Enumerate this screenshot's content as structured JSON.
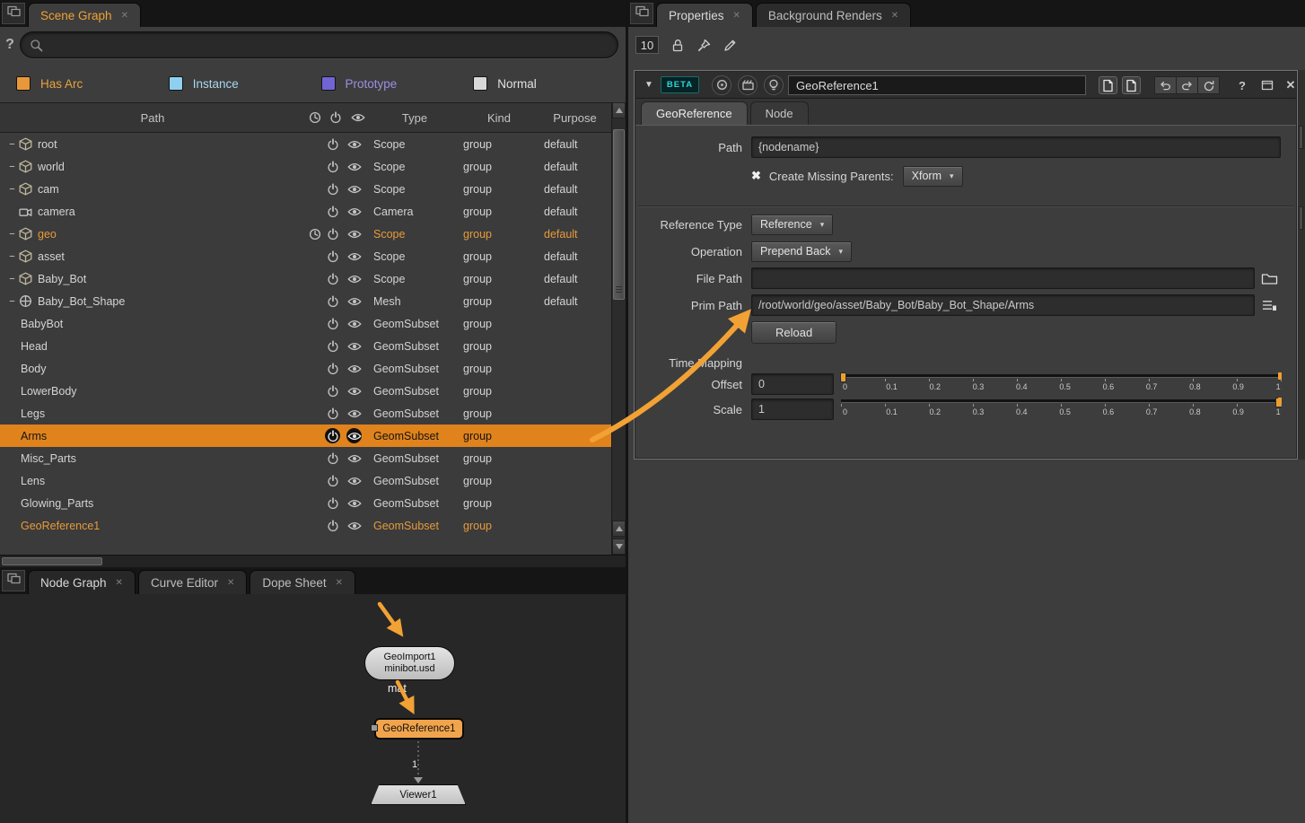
{
  "glyphs": {
    "close": "✕",
    "question": "?",
    "dd_arrow": "▾",
    "tri_down": "▼",
    "check_x": "✖",
    "collapse": "−"
  },
  "colors": {
    "accent": "#f0a132",
    "selection": "#e0831c"
  },
  "scene_graph_panel": {
    "tab_label": "Scene Graph",
    "search_value": "",
    "legend": [
      {
        "label": "Has Arc",
        "swatch": "#e8973a",
        "text_color": "#e8a33d"
      },
      {
        "label": "Instance",
        "swatch": "#8fd0f0",
        "text_color": "#a9d7ef"
      },
      {
        "label": "Prototype",
        "swatch": "#7164d4",
        "text_color": "#9b8fe2"
      },
      {
        "label": "Normal",
        "swatch": "#d8d8d8",
        "text_color": "#e2e2e2"
      }
    ],
    "header": {
      "path": "Path",
      "type": "Type",
      "kind": "Kind",
      "purpose": "Purpose"
    },
    "rows": [
      {
        "name": "root",
        "depth": 0,
        "icon": "cube-icon",
        "expander": true,
        "clock": false,
        "type": "Scope",
        "kind": "group",
        "purpose": "default",
        "state": "normal"
      },
      {
        "name": "world",
        "depth": 1,
        "icon": "cube-icon",
        "expander": true,
        "clock": false,
        "type": "Scope",
        "kind": "group",
        "purpose": "default",
        "state": "normal"
      },
      {
        "name": "cam",
        "depth": 2,
        "icon": "cube-icon",
        "expander": true,
        "clock": false,
        "type": "Scope",
        "kind": "group",
        "purpose": "default",
        "state": "normal"
      },
      {
        "name": "camera",
        "depth": 3,
        "icon": "camera-icon",
        "expander": false,
        "clock": false,
        "type": "Camera",
        "kind": "group",
        "purpose": "default",
        "state": "normal"
      },
      {
        "name": "geo",
        "depth": 2,
        "icon": "cube-icon",
        "expander": true,
        "clock": true,
        "type": "Scope",
        "kind": "group",
        "purpose": "default",
        "state": "arc"
      },
      {
        "name": "asset",
        "depth": 3,
        "icon": "cube-icon",
        "expander": true,
        "clock": false,
        "type": "Scope",
        "kind": "group",
        "purpose": "default",
        "state": "normal"
      },
      {
        "name": "Baby_Bot",
        "depth": 4,
        "icon": "cube-icon",
        "expander": true,
        "clock": false,
        "type": "Scope",
        "kind": "group",
        "purpose": "default",
        "state": "normal"
      },
      {
        "name": "Baby_Bot_Shape",
        "depth": 5,
        "icon": "mesh-icon",
        "expander": true,
        "clock": false,
        "type": "Mesh",
        "kind": "group",
        "purpose": "default",
        "state": "normal"
      },
      {
        "name": "BabyBot",
        "depth": 6,
        "icon": "",
        "expander": false,
        "clock": false,
        "type": "GeomSubset",
        "kind": "group",
        "purpose": "",
        "state": "normal"
      },
      {
        "name": "Head",
        "depth": 6,
        "icon": "",
        "expander": false,
        "clock": false,
        "type": "GeomSubset",
        "kind": "group",
        "purpose": "",
        "state": "normal"
      },
      {
        "name": "Body",
        "depth": 6,
        "icon": "",
        "expander": false,
        "clock": false,
        "type": "GeomSubset",
        "kind": "group",
        "purpose": "",
        "state": "normal"
      },
      {
        "name": "LowerBody",
        "depth": 6,
        "icon": "",
        "expander": false,
        "clock": false,
        "type": "GeomSubset",
        "kind": "group",
        "purpose": "",
        "state": "normal"
      },
      {
        "name": "Legs",
        "depth": 6,
        "icon": "",
        "expander": false,
        "clock": false,
        "type": "GeomSubset",
        "kind": "group",
        "purpose": "",
        "state": "normal"
      },
      {
        "name": "Arms",
        "depth": 6,
        "icon": "",
        "expander": false,
        "clock": false,
        "type": "GeomSubset",
        "kind": "group",
        "purpose": "",
        "state": "selected"
      },
      {
        "name": "Misc_Parts",
        "depth": 6,
        "icon": "",
        "expander": false,
        "clock": false,
        "type": "GeomSubset",
        "kind": "group",
        "purpose": "",
        "state": "normal"
      },
      {
        "name": "Lens",
        "depth": 6,
        "icon": "",
        "expander": false,
        "clock": false,
        "type": "GeomSubset",
        "kind": "group",
        "purpose": "",
        "state": "normal"
      },
      {
        "name": "Glowing_Parts",
        "depth": 6,
        "icon": "",
        "expander": false,
        "clock": false,
        "type": "GeomSubset",
        "kind": "group",
        "purpose": "",
        "state": "normal"
      },
      {
        "name": "GeoReference1",
        "depth": 1,
        "icon": "",
        "expander": false,
        "clock": false,
        "type": "GeomSubset",
        "kind": "group",
        "purpose": "",
        "state": "arc"
      }
    ]
  },
  "properties_panel": {
    "tab_properties": "Properties",
    "tab_background_renders": "Background Renders",
    "toolbar_number": "10",
    "node": {
      "beta_label": "BETA",
      "name_value": "GeoReference1",
      "tab_georeference": "GeoReference",
      "tab_node": "Node",
      "path_label": "Path",
      "path_value": "{nodename}",
      "create_missing_label": "Create Missing Parents:",
      "create_missing_value": "Xform",
      "reference_type_label": "Reference Type",
      "reference_type_value": "Reference",
      "operation_label": "Operation",
      "operation_value": "Prepend Back",
      "file_path_label": "File Path",
      "file_path_value": "",
      "prim_path_label": "Prim Path",
      "prim_path_value": "/root/world/geo/asset/Baby_Bot/Baby_Bot_Shape/Arms",
      "reload_label": "Reload",
      "time_mapping_label": "Time Mapping",
      "offset_label": "Offset",
      "offset_value": "0",
      "scale_label": "Scale",
      "scale_value": "1",
      "slider_ticks": [
        "0",
        "0.1",
        "0.2",
        "0.3",
        "0.4",
        "0.5",
        "0.6",
        "0.7",
        "0.8",
        "0.9",
        "1"
      ]
    }
  },
  "node_graph_panel": {
    "tab_node_graph": "Node Graph",
    "tab_curve_editor": "Curve Editor",
    "tab_dope_sheet": "Dope Sheet",
    "nodes": {
      "geo_import_line1": "GeoImport1",
      "geo_import_line2": "minibot.usd",
      "mat_label": "mat",
      "geo_reference_label": "GeoReference1",
      "connection_label": "1",
      "viewer_label": "Viewer1"
    }
  }
}
